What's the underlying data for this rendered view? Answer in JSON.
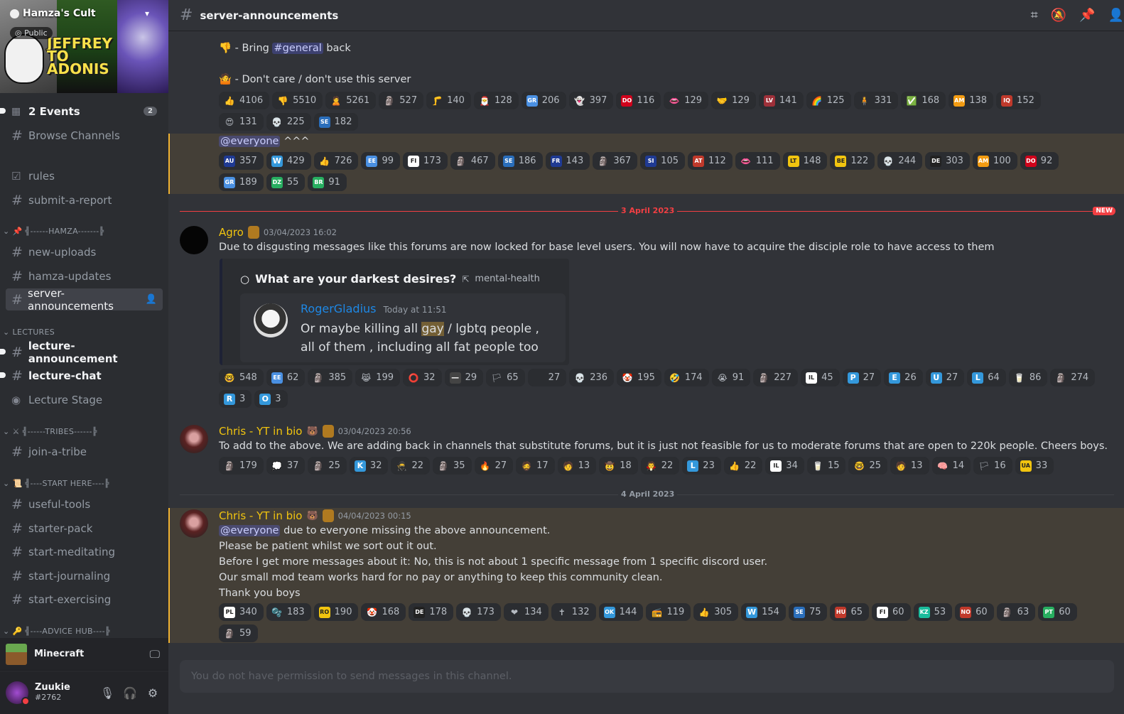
{
  "server": {
    "name": "Hamza's Cult",
    "visibility": "Public",
    "banner_text": "JEFFREY TO ADONIS"
  },
  "sidebar": {
    "events": {
      "label": "2 Events",
      "count": "2"
    },
    "browse": "Browse Channels",
    "channels": {
      "rules": "rules",
      "submit": "submit-a-report",
      "new_uploads": "new-uploads",
      "hamza_updates": "hamza-updates",
      "server_announcements": "server-announcements",
      "lecture_announcement": "lecture-announcement",
      "lecture_chat": "lecture-chat",
      "lecture_stage": "Lecture Stage",
      "join_tribe": "join-a-tribe",
      "useful_tools": "useful-tools",
      "starter_pack": "starter-pack",
      "start_meditating": "start-meditating",
      "start_journaling": "start-journaling",
      "start_exercising": "start-exercising"
    },
    "categories": {
      "hamza": "╣------HAMZA-------╠",
      "lectures": "LECTURES",
      "tribes": "╣------TRIBES------╠",
      "start_here": "╣----START HERE----╠",
      "advice": "╣----ADVICE HUB----╠"
    },
    "activity": "Minecraft",
    "user": {
      "name": "Zuukie",
      "tag": "#2762"
    }
  },
  "header": {
    "channel": "server-announcements"
  },
  "messages": {
    "m0": {
      "line1_pre": "- Bring",
      "line1_mention": "#general",
      "line1_post": "back",
      "line2": "- Don't care / don't use this server"
    },
    "m1": {
      "mention": "@everyone",
      "tail": "^^^"
    },
    "divider_date1": "3 April 2023",
    "new_label": "NEW",
    "m2": {
      "author": "Agro",
      "timestamp": "03/04/2023 16:02",
      "text": "Due to disgusting messages like this forums are now locked for base level users. You will now have to acquire the disciple role to have access to them",
      "embed": {
        "title": "What are your darkest desires?",
        "forum": "mental-health",
        "user": "RogerGladius",
        "time": "Today at 11:51",
        "text_pre": "Or maybe killing all",
        "text_hl": "gay",
        "text_post": "/ lgbtq people , all of them , including all fat people too"
      }
    },
    "m3": {
      "author": "Chris - YT in bio",
      "timestamp": "03/04/2023 20:56",
      "text": "To add to the above. We are adding back in channels that substitute forums, but it is just not feasible for us to moderate forums that are open to 220k people. Cheers boys."
    },
    "divider_date2": "4 April 2023",
    "m4": {
      "author": "Chris - YT in bio",
      "timestamp": "04/04/2023 00:15",
      "mention": "@everyone",
      "line1": "due to everyone missing the above announcement.",
      "line2": "Please be patient whilst we sort out it out.",
      "line3": "Before I get more messages about it: No, this is not about 1 specific message from 1 specific discord user.",
      "line4": "Our small mod team works hard for no pay or anything to keep this community clean.",
      "line5": "Thank you boys"
    }
  },
  "reactions": {
    "r0": [
      {
        "e": "👍",
        "c": "4106",
        "bg": "#ffcc4d"
      },
      {
        "e": "👎",
        "c": "5510",
        "bg": "#ffcc4d"
      },
      {
        "e": "🙎",
        "c": "5261",
        "bg": "#ffcc4d"
      },
      {
        "e": "🗿",
        "c": "527",
        "bg": "#b07a20"
      },
      {
        "e": "🦵",
        "c": "140",
        "bg": "#d9534f"
      },
      {
        "e": "🎅",
        "c": "128",
        "bg": "#ffffff"
      },
      {
        "e": "GR",
        "c": "206",
        "bg": "#4a90e2"
      },
      {
        "e": "👻",
        "c": "397",
        "bg": "#8e44ad"
      },
      {
        "e": "DO",
        "c": "116",
        "bg": "#d0021b"
      },
      {
        "e": "👄",
        "c": "129",
        "bg": "#e74c3c"
      },
      {
        "e": "🤝",
        "c": "129",
        "bg": "#ffcc4d"
      },
      {
        "e": "LV",
        "c": "141",
        "bg": "#9e3039"
      },
      {
        "e": "🌈",
        "c": "125",
        "bg": "#ffcc4d"
      },
      {
        "e": "🧍",
        "c": "331",
        "bg": "#a1887f"
      },
      {
        "e": "✅",
        "c": "168",
        "bg": "#43b581"
      },
      {
        "e": "AM",
        "c": "138",
        "bg": "#f39c12"
      },
      {
        "e": "IQ",
        "c": "152",
        "bg": "#c0392b"
      }
    ],
    "r0b": [
      {
        "e": "😍",
        "c": "131",
        "bg": "#ffcc4d"
      },
      {
        "e": "💀",
        "c": "225",
        "bg": "#dddddd"
      },
      {
        "e": "SE",
        "c": "182",
        "bg": "#2a6ebb"
      }
    ],
    "r1": [
      {
        "e": "AU",
        "c": "357",
        "bg": "#1f3a93"
      },
      {
        "e": "W",
        "c": "429",
        "bg": "#3498db"
      },
      {
        "e": "👍",
        "c": "726",
        "bg": "#ffcc4d"
      },
      {
        "e": "EE",
        "c": "99",
        "bg": "#4a90e2"
      },
      {
        "e": "FI",
        "c": "173",
        "bg": "#ffffff"
      },
      {
        "e": "🗿",
        "c": "467",
        "bg": "#555555"
      },
      {
        "e": "SE",
        "c": "186",
        "bg": "#2a6ebb"
      },
      {
        "e": "FR",
        "c": "143",
        "bg": "#1f3a93"
      },
      {
        "e": "🗿",
        "c": "367",
        "bg": "#b07a20"
      },
      {
        "e": "SI",
        "c": "105",
        "bg": "#1f3a93"
      },
      {
        "e": "AT",
        "c": "112",
        "bg": "#c0392b"
      },
      {
        "e": "👄",
        "c": "111",
        "bg": "#e74c3c"
      },
      {
        "e": "LT",
        "c": "148",
        "bg": "#f1c40f"
      },
      {
        "e": "BE",
        "c": "122",
        "bg": "#f1c40f"
      },
      {
        "e": "💀",
        "c": "244",
        "bg": "#dddddd"
      },
      {
        "e": "DE",
        "c": "303",
        "bg": "#222222"
      },
      {
        "e": "AM",
        "c": "100",
        "bg": "#f39c12"
      },
      {
        "e": "DO",
        "c": "92",
        "bg": "#d0021b"
      }
    ],
    "r1b": [
      {
        "e": "GR",
        "c": "189",
        "bg": "#4a90e2"
      },
      {
        "e": "DZ",
        "c": "55",
        "bg": "#27ae60"
      },
      {
        "e": "BR",
        "c": "91",
        "bg": "#27ae60"
      }
    ],
    "r2": [
      {
        "e": "🤓",
        "c": "548",
        "bg": "#ffcc4d"
      },
      {
        "e": "EE",
        "c": "62",
        "bg": "#4a90e2"
      },
      {
        "e": "🗿",
        "c": "385",
        "bg": "#555555"
      },
      {
        "e": "😹",
        "c": "199",
        "bg": "#ffcc4d"
      },
      {
        "e": "⭕",
        "c": "32",
        "bg": "#c0392b"
      },
      {
        "e": "—",
        "c": "29",
        "bg": "#444444"
      },
      {
        "e": "🏳",
        "c": "65",
        "bg": "#e67e22"
      },
      {
        "e": " ",
        "c": "27",
        "bg": "#2b2d31"
      },
      {
        "e": "💀",
        "c": "236",
        "bg": "#dddddd"
      },
      {
        "e": "🤡",
        "c": "195",
        "bg": "#ffffff"
      },
      {
        "e": "🤣",
        "c": "174",
        "bg": "#ffcc4d"
      },
      {
        "e": "😭",
        "c": "91",
        "bg": "#ffcc4d"
      },
      {
        "e": "🗿",
        "c": "227",
        "bg": "#b07a20"
      },
      {
        "e": "IL",
        "c": "45",
        "bg": "#ffffff"
      },
      {
        "e": "P",
        "c": "27",
        "bg": "#3498db"
      },
      {
        "e": "E",
        "c": "26",
        "bg": "#3498db"
      },
      {
        "e": "U",
        "c": "27",
        "bg": "#3498db"
      },
      {
        "e": "L",
        "c": "64",
        "bg": "#3498db"
      },
      {
        "e": "🥛",
        "c": "86",
        "bg": "#cccccc"
      },
      {
        "e": "🗿",
        "c": "274",
        "bg": "#555555"
      }
    ],
    "r2b": [
      {
        "e": "R",
        "c": "3",
        "bg": "#3498db"
      },
      {
        "e": "O",
        "c": "3",
        "bg": "#3498db"
      }
    ],
    "r3": [
      {
        "e": "🗿",
        "c": "179",
        "bg": "#555555"
      },
      {
        "e": "💭",
        "c": "37",
        "bg": "#dddddd"
      },
      {
        "e": "🗿",
        "c": "25",
        "bg": "#cccccc"
      },
      {
        "e": "K",
        "c": "32",
        "bg": "#3498db"
      },
      {
        "e": "🥷",
        "c": "22",
        "bg": "#d0021b"
      },
      {
        "e": "🗿",
        "c": "35",
        "bg": "#555555"
      },
      {
        "e": "🔥",
        "c": "27",
        "bg": "#e67e22"
      },
      {
        "e": "🧔",
        "c": "17",
        "bg": "#c0392b"
      },
      {
        "e": "🧑",
        "c": "13",
        "bg": "#a1887f"
      },
      {
        "e": "🤠",
        "c": "18",
        "bg": "#ffcc4d"
      },
      {
        "e": "🧛",
        "c": "22",
        "bg": "#8e44ad"
      },
      {
        "e": "L",
        "c": "23",
        "bg": "#3498db"
      },
      {
        "e": "👍",
        "c": "22",
        "bg": "#ffcc4d"
      },
      {
        "e": "IL",
        "c": "34",
        "bg": "#ffffff"
      },
      {
        "e": "🥛",
        "c": "15",
        "bg": "#cccccc"
      },
      {
        "e": "🤓",
        "c": "25",
        "bg": "#ffcc4d"
      },
      {
        "e": "🧑",
        "c": "13",
        "bg": "#e67e22"
      },
      {
        "e": "🧠",
        "c": "14",
        "bg": "#dddddd"
      },
      {
        "e": "🏳",
        "c": "16",
        "bg": "#e67e22"
      },
      {
        "e": "UA",
        "c": "33",
        "bg": "#f1c40f"
      }
    ],
    "r4": [
      {
        "e": "PL",
        "c": "340",
        "bg": "#ffffff"
      },
      {
        "e": "🫧",
        "c": "183",
        "bg": "#3498db"
      },
      {
        "e": "RO",
        "c": "190",
        "bg": "#f1c40f"
      },
      {
        "e": "🤡",
        "c": "168",
        "bg": "#ffffff"
      },
      {
        "e": "DE",
        "c": "178",
        "bg": "#222222"
      },
      {
        "e": "💀",
        "c": "173",
        "bg": "#dddddd"
      },
      {
        "e": "❤",
        "c": "134",
        "bg": "#d0021b"
      },
      {
        "e": "✝",
        "c": "132",
        "bg": "#8e6fd1"
      },
      {
        "e": "OK",
        "c": "144",
        "bg": "#3498db"
      },
      {
        "e": "📻",
        "c": "119",
        "bg": "#444444"
      },
      {
        "e": "👍",
        "c": "305",
        "bg": "#ffcc4d"
      },
      {
        "e": "W",
        "c": "154",
        "bg": "#3498db"
      },
      {
        "e": "SE",
        "c": "75",
        "bg": "#2a6ebb"
      },
      {
        "e": "HU",
        "c": "65",
        "bg": "#c0392b"
      },
      {
        "e": "FI",
        "c": "60",
        "bg": "#ffffff"
      },
      {
        "e": "KZ",
        "c": "53",
        "bg": "#1abc9c"
      },
      {
        "e": "NO",
        "c": "60",
        "bg": "#c0392b"
      },
      {
        "e": "🗿",
        "c": "63",
        "bg": "#888888"
      },
      {
        "e": "PT",
        "c": "60",
        "bg": "#27ae60"
      }
    ],
    "r4b": [
      {
        "e": "🗿",
        "c": "59",
        "bg": "#888888"
      }
    ]
  },
  "input": {
    "placeholder": "You do not have permission to send messages in this channel."
  }
}
